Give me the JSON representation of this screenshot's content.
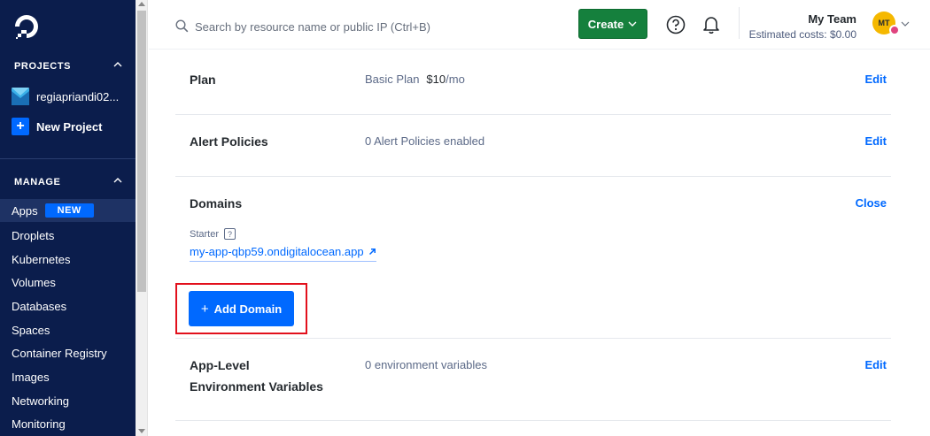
{
  "sidebar": {
    "projects_heading": "PROJECTS",
    "project_name": "regiapriandi02...",
    "new_project_label": "New Project",
    "manage_heading": "MANAGE",
    "nav": [
      {
        "label": "Apps",
        "active": true,
        "badge": "NEW"
      },
      {
        "label": "Droplets"
      },
      {
        "label": "Kubernetes"
      },
      {
        "label": "Volumes"
      },
      {
        "label": "Databases"
      },
      {
        "label": "Spaces"
      },
      {
        "label": "Container Registry"
      },
      {
        "label": "Images"
      },
      {
        "label": "Networking"
      },
      {
        "label": "Monitoring"
      }
    ]
  },
  "topbar": {
    "search_placeholder": "Search by resource name or public IP (Ctrl+B)",
    "create_label": "Create",
    "team_name": "My Team",
    "estimated_costs": "Estimated costs: $0.00",
    "avatar_initials": "MT"
  },
  "settings": {
    "plan": {
      "title": "Plan",
      "value": "Basic Plan",
      "price": "$10",
      "price_unit": "/mo",
      "action": "Edit"
    },
    "alert_policies": {
      "title": "Alert Policies",
      "value": "0 Alert Policies enabled",
      "action": "Edit"
    },
    "domains": {
      "title": "Domains",
      "action": "Close",
      "starter_label": "Starter",
      "help_mark": "?",
      "app_url": "my-app-qbp59.ondigitalocean.app",
      "add_domain_label": "Add Domain"
    },
    "env_vars": {
      "title_line1": "App-Level",
      "title_line2": "Environment Variables",
      "value": "0 environment variables",
      "action": "Edit"
    }
  },
  "colors": {
    "sidebar_bg": "#0b1d4c",
    "accent": "#0069ff",
    "create_bg": "#15803d",
    "highlight": "#e2101c"
  }
}
